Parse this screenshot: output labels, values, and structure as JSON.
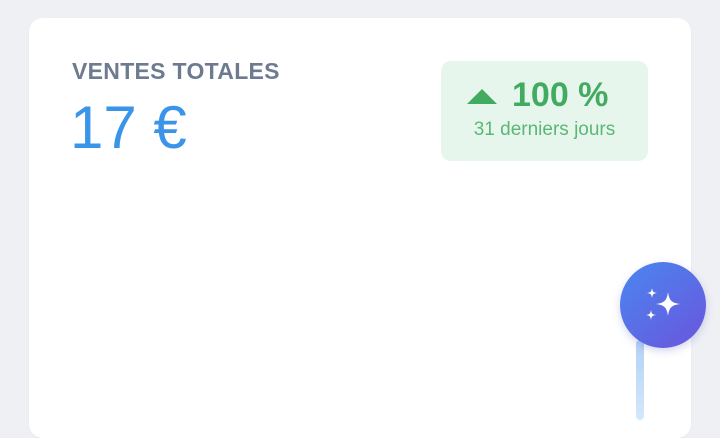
{
  "card": {
    "title": "VENTES TOTALES",
    "value": "17 €"
  },
  "badge": {
    "percent": "100 %",
    "period": "31 derniers jours",
    "trend_icon": "triangle-up-icon",
    "color": "#43ab61"
  },
  "fab": {
    "icon": "sparkles-icon",
    "gradient_start": "#4b86f0",
    "gradient_end": "#6a55dc"
  },
  "colors": {
    "background": "#eef0f4",
    "card": "#ffffff",
    "title": "#6e7a90",
    "value": "#3a94e8",
    "badge_bg": "#e7f6ec"
  }
}
